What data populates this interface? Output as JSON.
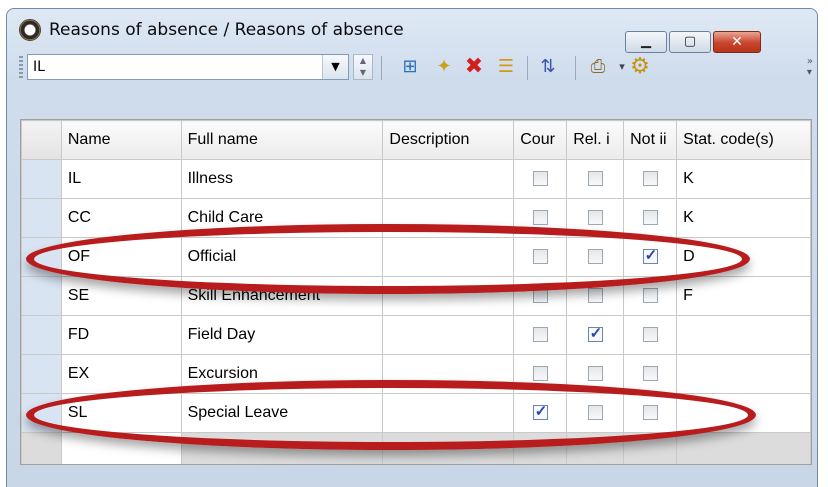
{
  "window": {
    "title": "Reasons of absence / Reasons of absence",
    "min_glyph": "▁",
    "max_glyph": "▢",
    "close_glyph": "✕"
  },
  "toolbar": {
    "combo_value": "IL",
    "combo_arrow": "▼",
    "spin_glyph": "▲\n▼",
    "buttons": [
      {
        "name": "move-icon",
        "glyph": "⊞"
      },
      {
        "name": "new-icon",
        "glyph": "✦"
      },
      {
        "name": "delete-icon",
        "glyph": "✖"
      },
      {
        "name": "list-icon",
        "glyph": "☰"
      },
      {
        "name": "sort-icon",
        "glyph": "⇅"
      },
      {
        "name": "print-preview-icon",
        "glyph": "⎙"
      },
      {
        "name": "settings-icon",
        "glyph": "⚙"
      }
    ],
    "dropdown_arrow": "▾",
    "overflow_glyph": "»\n▾"
  },
  "grid": {
    "columns": [
      "Name",
      "Full name",
      "Description",
      "Cour",
      "Rel. i",
      "Not ii",
      "Stat. code(s)"
    ],
    "rows": [
      {
        "name": "IL",
        "full": "Illness",
        "desc": "",
        "c1": false,
        "c2": false,
        "c3": false,
        "code": "K"
      },
      {
        "name": "CC",
        "full": "Child Care",
        "desc": "",
        "c1": false,
        "c2": false,
        "c3": false,
        "code": "K"
      },
      {
        "name": "OF",
        "full": "Official",
        "desc": "",
        "c1": false,
        "c2": false,
        "c3": true,
        "code": "D"
      },
      {
        "name": "SE",
        "full": "Skill Enhancement",
        "desc": "",
        "c1": false,
        "c2": false,
        "c3": false,
        "code": "F"
      },
      {
        "name": "FD",
        "full": "Field Day",
        "desc": "",
        "c1": false,
        "c2": true,
        "c3": false,
        "code": ""
      },
      {
        "name": "EX",
        "full": "Excursion",
        "desc": "",
        "c1": false,
        "c2": false,
        "c3": false,
        "code": ""
      },
      {
        "name": "SL",
        "full": "Special Leave",
        "desc": "",
        "c1": true,
        "c2": false,
        "c3": false,
        "code": ""
      }
    ]
  },
  "colors": {
    "annotation_red": "#b81c1c",
    "close_button": "#c8442c",
    "checkmark": "#2748a8"
  }
}
